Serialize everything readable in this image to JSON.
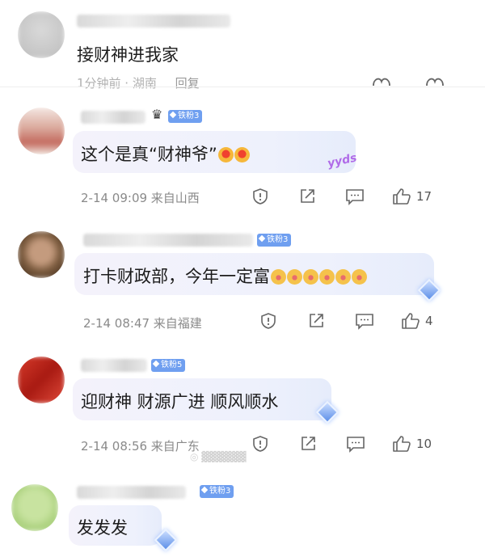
{
  "comments": [
    {
      "text": "接财神进我家",
      "meta": "1分钟前 · 湖南",
      "reply_label": "回复"
    },
    {
      "badge": "铁粉3",
      "text": "这个是真“财神爷”",
      "decor_text": "yyds",
      "meta": "2-14 09:09 来自山西",
      "likes": "17"
    },
    {
      "badge": "铁粉3",
      "text": "打卡财政部，今年一定富",
      "meta": "2-14 08:47 来自福建",
      "likes": "4"
    },
    {
      "badge": "铁粉5",
      "text": "迎财神 财源广进 顺风顺水",
      "meta": "2-14 08:56 来自广东",
      "likes": "10"
    },
    {
      "badge": "铁粉3",
      "text": "发发发"
    }
  ],
  "icons": [
    "report-icon",
    "share-icon",
    "comment-icon",
    "like-icon",
    "heart-icon"
  ],
  "colors": {
    "badge": "#6f9ff0",
    "meta": "#8a8a8a",
    "bubble": "#eef1fc"
  }
}
